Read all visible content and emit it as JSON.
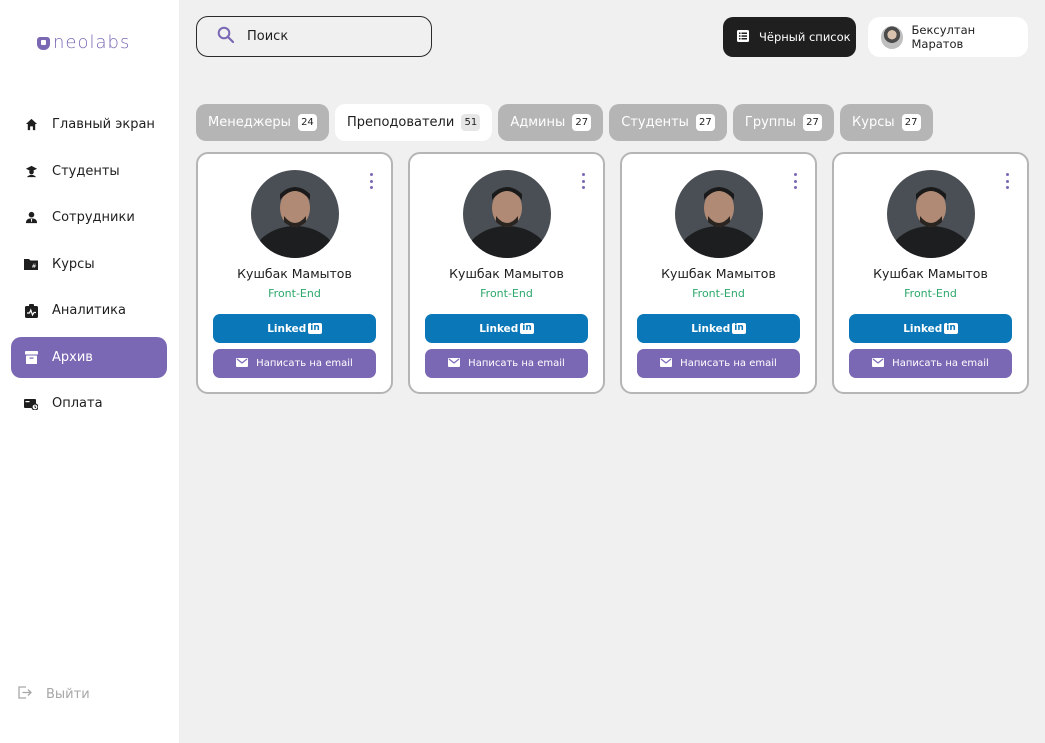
{
  "brand": {
    "logo_text": "neolabs",
    "accent_color": "#7b68b5"
  },
  "sidebar": {
    "items": [
      {
        "label": "Главный экран",
        "icon": "home-icon",
        "active": false
      },
      {
        "label": "Студенты",
        "icon": "student-icon",
        "active": false
      },
      {
        "label": "Сотрудники",
        "icon": "staff-icon",
        "active": false
      },
      {
        "label": "Курсы",
        "icon": "folder-icon",
        "active": false
      },
      {
        "label": "Аналитика",
        "icon": "analytics-icon",
        "active": false
      },
      {
        "label": "Архив",
        "icon": "archive-icon",
        "active": true
      },
      {
        "label": "Оплата",
        "icon": "payment-icon",
        "active": false
      }
    ],
    "logout_label": "Выйти"
  },
  "header": {
    "search_placeholder": "Поиск",
    "blacklist_label": "Чёрный список",
    "user_name": "Бексултан Маратов"
  },
  "tabs": [
    {
      "label": "Менеджеры",
      "count": "24",
      "active": false
    },
    {
      "label": "Преподователи",
      "count": "51",
      "active": true
    },
    {
      "label": "Админы",
      "count": "27",
      "active": false
    },
    {
      "label": "Студенты",
      "count": "27",
      "active": false
    },
    {
      "label": "Группы",
      "count": "27",
      "active": false
    },
    {
      "label": "Курсы",
      "count": "27",
      "active": false
    }
  ],
  "cards": [
    {
      "name": "Кушбак Мамытов",
      "role": "Front-End",
      "linkedin_label": "Linked",
      "linkedin_badge": "in",
      "email_label": "Написать на email"
    },
    {
      "name": "Кушбак Мамытов",
      "role": "Front-End",
      "linkedin_label": "Linked",
      "linkedin_badge": "in",
      "email_label": "Написать на email"
    },
    {
      "name": "Кушбак Мамытов",
      "role": "Front-End",
      "linkedin_label": "Linked",
      "linkedin_badge": "in",
      "email_label": "Написать на email"
    },
    {
      "name": "Кушбак Мамытов",
      "role": "Front-End",
      "linkedin_label": "Linked",
      "linkedin_badge": "in",
      "email_label": "Написать на email"
    }
  ],
  "colors": {
    "linkedin": "#0a78b8",
    "role_text": "#2ca86b",
    "dark_button": "#1f1f1f",
    "tab_inactive": "#b5b5b5"
  }
}
